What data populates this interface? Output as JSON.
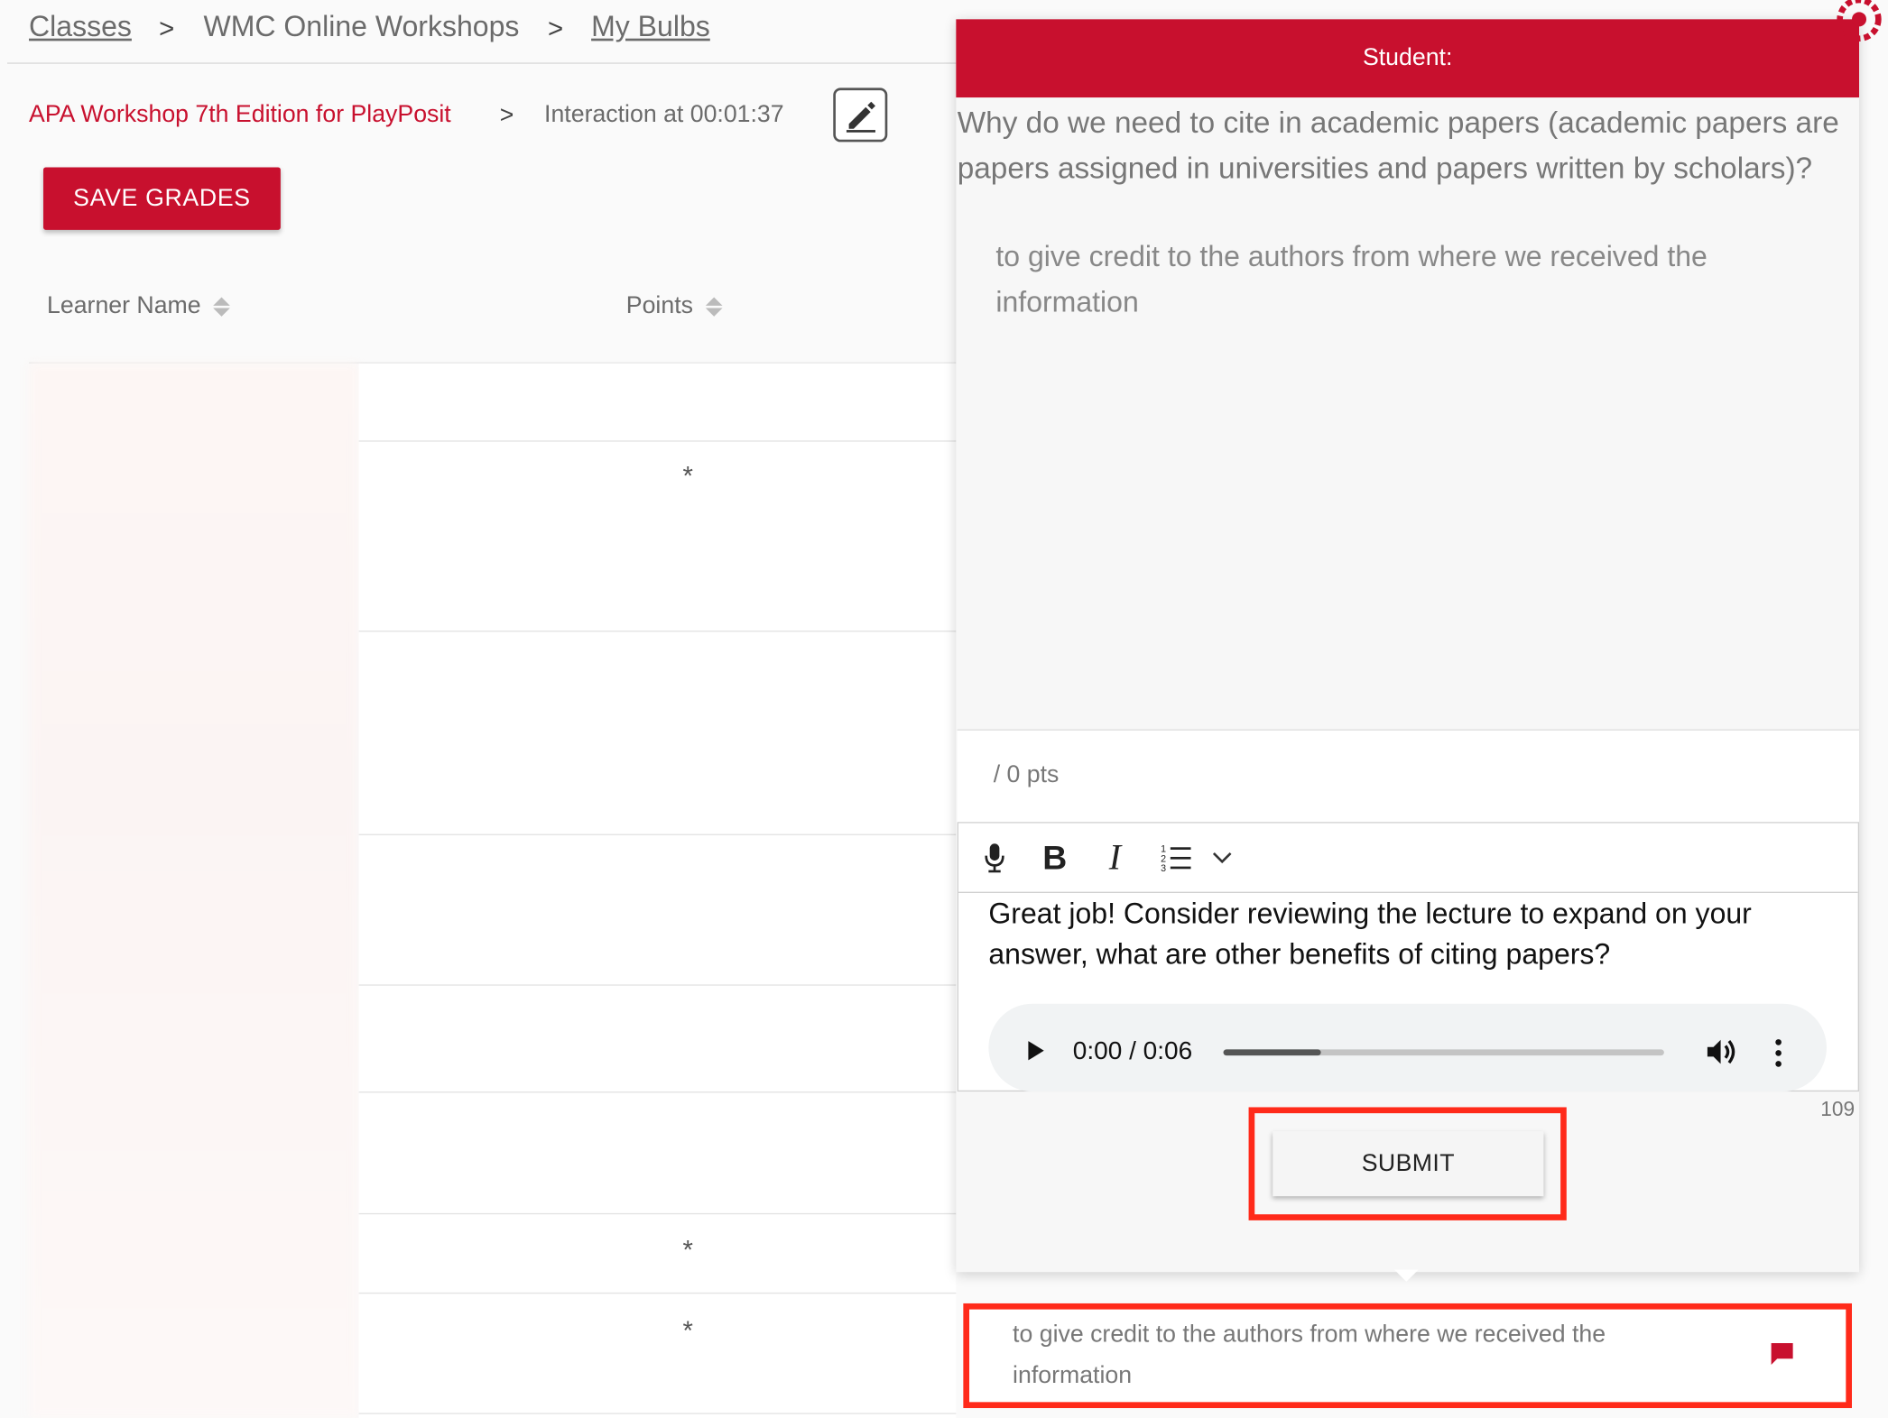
{
  "breadcrumb": {
    "classes": "Classes",
    "workshops": "WMC Online Workshops",
    "bulbs": "My Bulbs",
    "separator": ">"
  },
  "subheader": {
    "bulb_title": "APA Workshop 7th Edition for PlayPosit",
    "interaction": "Interaction at 00:01:37"
  },
  "actions": {
    "save_grades": "SAVE GRADES"
  },
  "table": {
    "col_learner": "Learner Name",
    "col_points": "Points",
    "row_markers": [
      "*",
      "*",
      "*"
    ]
  },
  "panel": {
    "header": "Student:",
    "question": "Why do we need to cite in academic papers (academic papers are papers assigned in universities and papers written by scholars)?",
    "answer": "to give credit to the authors from where we received the information",
    "points_suffix": "/ 0 pts",
    "feedback": "Great job! Consider reviewing the lecture to expand on your answer, what are other benefits of citing papers?",
    "audio_time": "0:00 / 0:06",
    "audio_progress": 0.22,
    "char_count": "109",
    "submit": "SUBMIT"
  },
  "response_row": {
    "text": "to give credit to the authors from where we received the information"
  },
  "colors": {
    "brand": "#c8102e",
    "highlight": "#ff2a1a"
  }
}
